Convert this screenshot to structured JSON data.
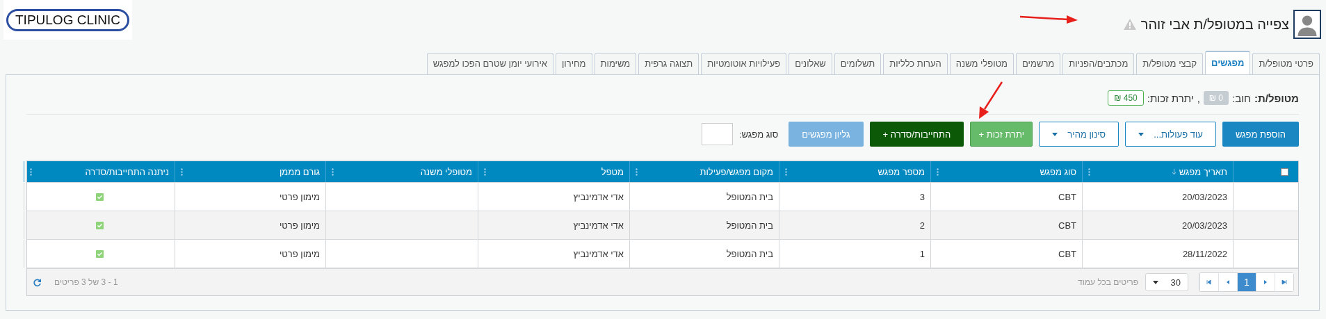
{
  "header": {
    "logo": "TIPULOG CLINIC",
    "viewing_notice": "צפייה במטופל/ת אבי זוהר"
  },
  "tabs": [
    {
      "label": "פרטי מטופל/ת",
      "selected": false
    },
    {
      "label": "מפגשים",
      "selected": true
    },
    {
      "label": "קבצי מטופל/ת",
      "selected": false
    },
    {
      "label": "מכתבים/הפניות",
      "selected": false
    },
    {
      "label": "מרשמים",
      "selected": false
    },
    {
      "label": "מטופלי משנה",
      "selected": false
    },
    {
      "label": "הערות כלליות",
      "selected": false
    },
    {
      "label": "תשלומים",
      "selected": false
    },
    {
      "label": "שאלונים",
      "selected": false
    },
    {
      "label": "פעילויות אוטומטיות",
      "selected": false
    },
    {
      "label": "תצוגה גרפית",
      "selected": false
    },
    {
      "label": "משימות",
      "selected": false
    },
    {
      "label": "מחירון",
      "selected": false
    },
    {
      "label": "אירועי יומן שטרם הפכו למפגש",
      "selected": false
    }
  ],
  "balance": {
    "label": "מטופל/ת:",
    "debt_label": "חוב:",
    "debt": "₪ 0",
    "separator": ",",
    "credit_label": "יתרת זכות:",
    "credit": "₪ 450"
  },
  "toolbar": [
    {
      "kind": "primary",
      "label": "הוספת מפגש"
    },
    {
      "kind": "dropdown",
      "label": "עוד פעולות..."
    },
    {
      "kind": "dropdown",
      "label": "סינון מהיר"
    },
    {
      "kind": "success",
      "label": "יתרת זכות +"
    },
    {
      "kind": "dark",
      "label": "התחייבות/סדרה +"
    },
    {
      "kind": "light",
      "label": "גליון מפגשים"
    }
  ],
  "filter": {
    "label": "סוג מפגש:"
  },
  "table": {
    "select_all": {
      "checked": false
    },
    "columns": [
      {
        "label": "תאריך מפגש",
        "sorted": true
      },
      {
        "label": "סוג מפגש",
        "sorted": false
      },
      {
        "label": "מספר מפגש",
        "sorted": false
      },
      {
        "label": "מקום מפגש/פעילות",
        "sorted": false
      },
      {
        "label": "מטפל",
        "sorted": false
      },
      {
        "label": "מטופלי משנה",
        "sorted": false
      },
      {
        "label": "גורם מממן",
        "sorted": false
      },
      {
        "label": "ניתנה התחייבות/סדרה",
        "sorted": false
      }
    ],
    "rows": [
      {
        "date": "20/03/2023",
        "type": "CBT",
        "number": "3",
        "location": "בית המטופל",
        "therapist": "אדי אדמינביץ",
        "funder": "מימון פרטי",
        "commitment": true
      },
      {
        "date": "20/03/2023",
        "type": "CBT",
        "number": "2",
        "location": "בית המטופל",
        "therapist": "אדי אדמינביץ",
        "funder": "מימון פרטי",
        "commitment": true
      },
      {
        "date": "28/11/2022",
        "type": "CBT",
        "number": "1",
        "location": "בית המטופל",
        "therapist": "אדי אדמינביץ",
        "funder": "מימון פרטי",
        "commitment": true
      }
    ]
  },
  "pager": {
    "pages": [
      {
        "label": "1",
        "selected": true
      }
    ],
    "page_size": "30",
    "page_size_label": "פריטים בכל עמוד",
    "summary": "1 - 3 של 3 פריטים"
  }
}
